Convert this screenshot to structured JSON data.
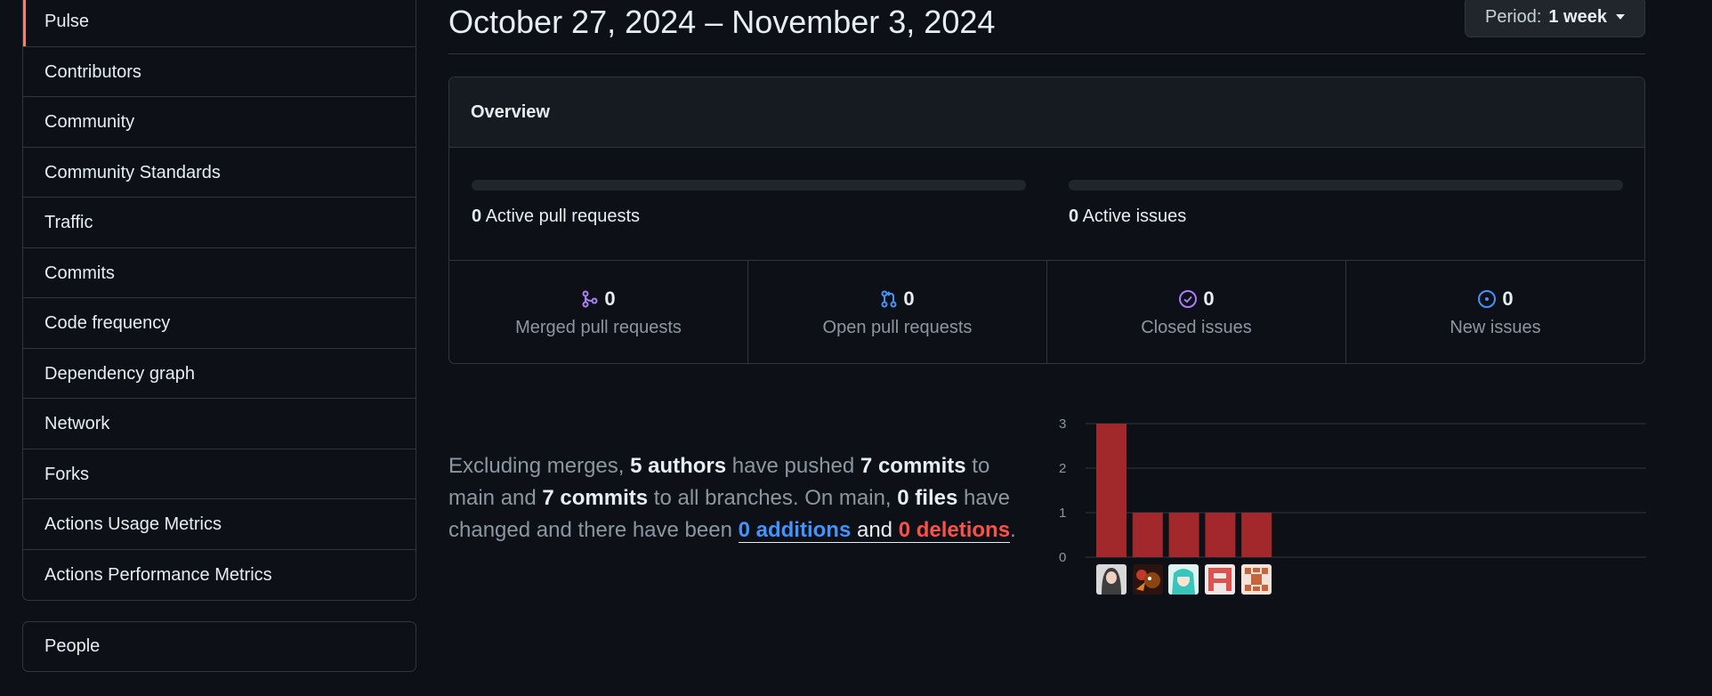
{
  "sidebar": {
    "items": [
      {
        "label": "Pulse",
        "selected": true
      },
      {
        "label": "Contributors"
      },
      {
        "label": "Community"
      },
      {
        "label": "Community Standards"
      },
      {
        "label": "Traffic"
      },
      {
        "label": "Commits"
      },
      {
        "label": "Code frequency"
      },
      {
        "label": "Dependency graph"
      },
      {
        "label": "Network"
      },
      {
        "label": "Forks"
      },
      {
        "label": "Actions Usage Metrics"
      },
      {
        "label": "Actions Performance Metrics"
      }
    ],
    "secondary": {
      "label": "People"
    }
  },
  "header": {
    "date_range": "October 27, 2024 – November 3, 2024",
    "period_label": "Period:",
    "period_value": "1 week"
  },
  "overview": {
    "title": "Overview",
    "active_prs": {
      "count": "0",
      "label": "Active pull requests"
    },
    "active_issues": {
      "count": "0",
      "label": "Active issues"
    },
    "stats": [
      {
        "icon": "merged-pr-icon",
        "value": "0",
        "label": "Merged pull requests",
        "color": "#ab7df8"
      },
      {
        "icon": "open-pr-icon",
        "value": "0",
        "label": "Open pull requests",
        "color": "#4493f8"
      },
      {
        "icon": "closed-issue-icon",
        "value": "0",
        "label": "Closed issues",
        "color": "#ab7df8"
      },
      {
        "icon": "new-issue-icon",
        "value": "0",
        "label": "New issues",
        "color": "#4493f8"
      }
    ]
  },
  "summary": {
    "t1": "Excluding merges, ",
    "authors": "5 authors",
    "t2": " have pushed ",
    "commits_main": "7 commits",
    "t3": " to main and ",
    "commits_all": "7 commits",
    "t4": " to all branches. On main, ",
    "files": "0 files",
    "t5": " have changed and there have been ",
    "additions": "0 additions",
    "t6": " and ",
    "deletions": "0 deletions",
    "t7": "."
  },
  "chart_data": {
    "type": "bar",
    "categories": [
      "author-1",
      "author-2",
      "author-3",
      "author-4",
      "author-5"
    ],
    "values": [
      3,
      1,
      1,
      1,
      1
    ],
    "ylim": [
      0,
      3
    ],
    "y_ticks": [
      "0",
      "1",
      "2",
      "3"
    ],
    "bar_color": "#a3282c",
    "grid": true
  }
}
